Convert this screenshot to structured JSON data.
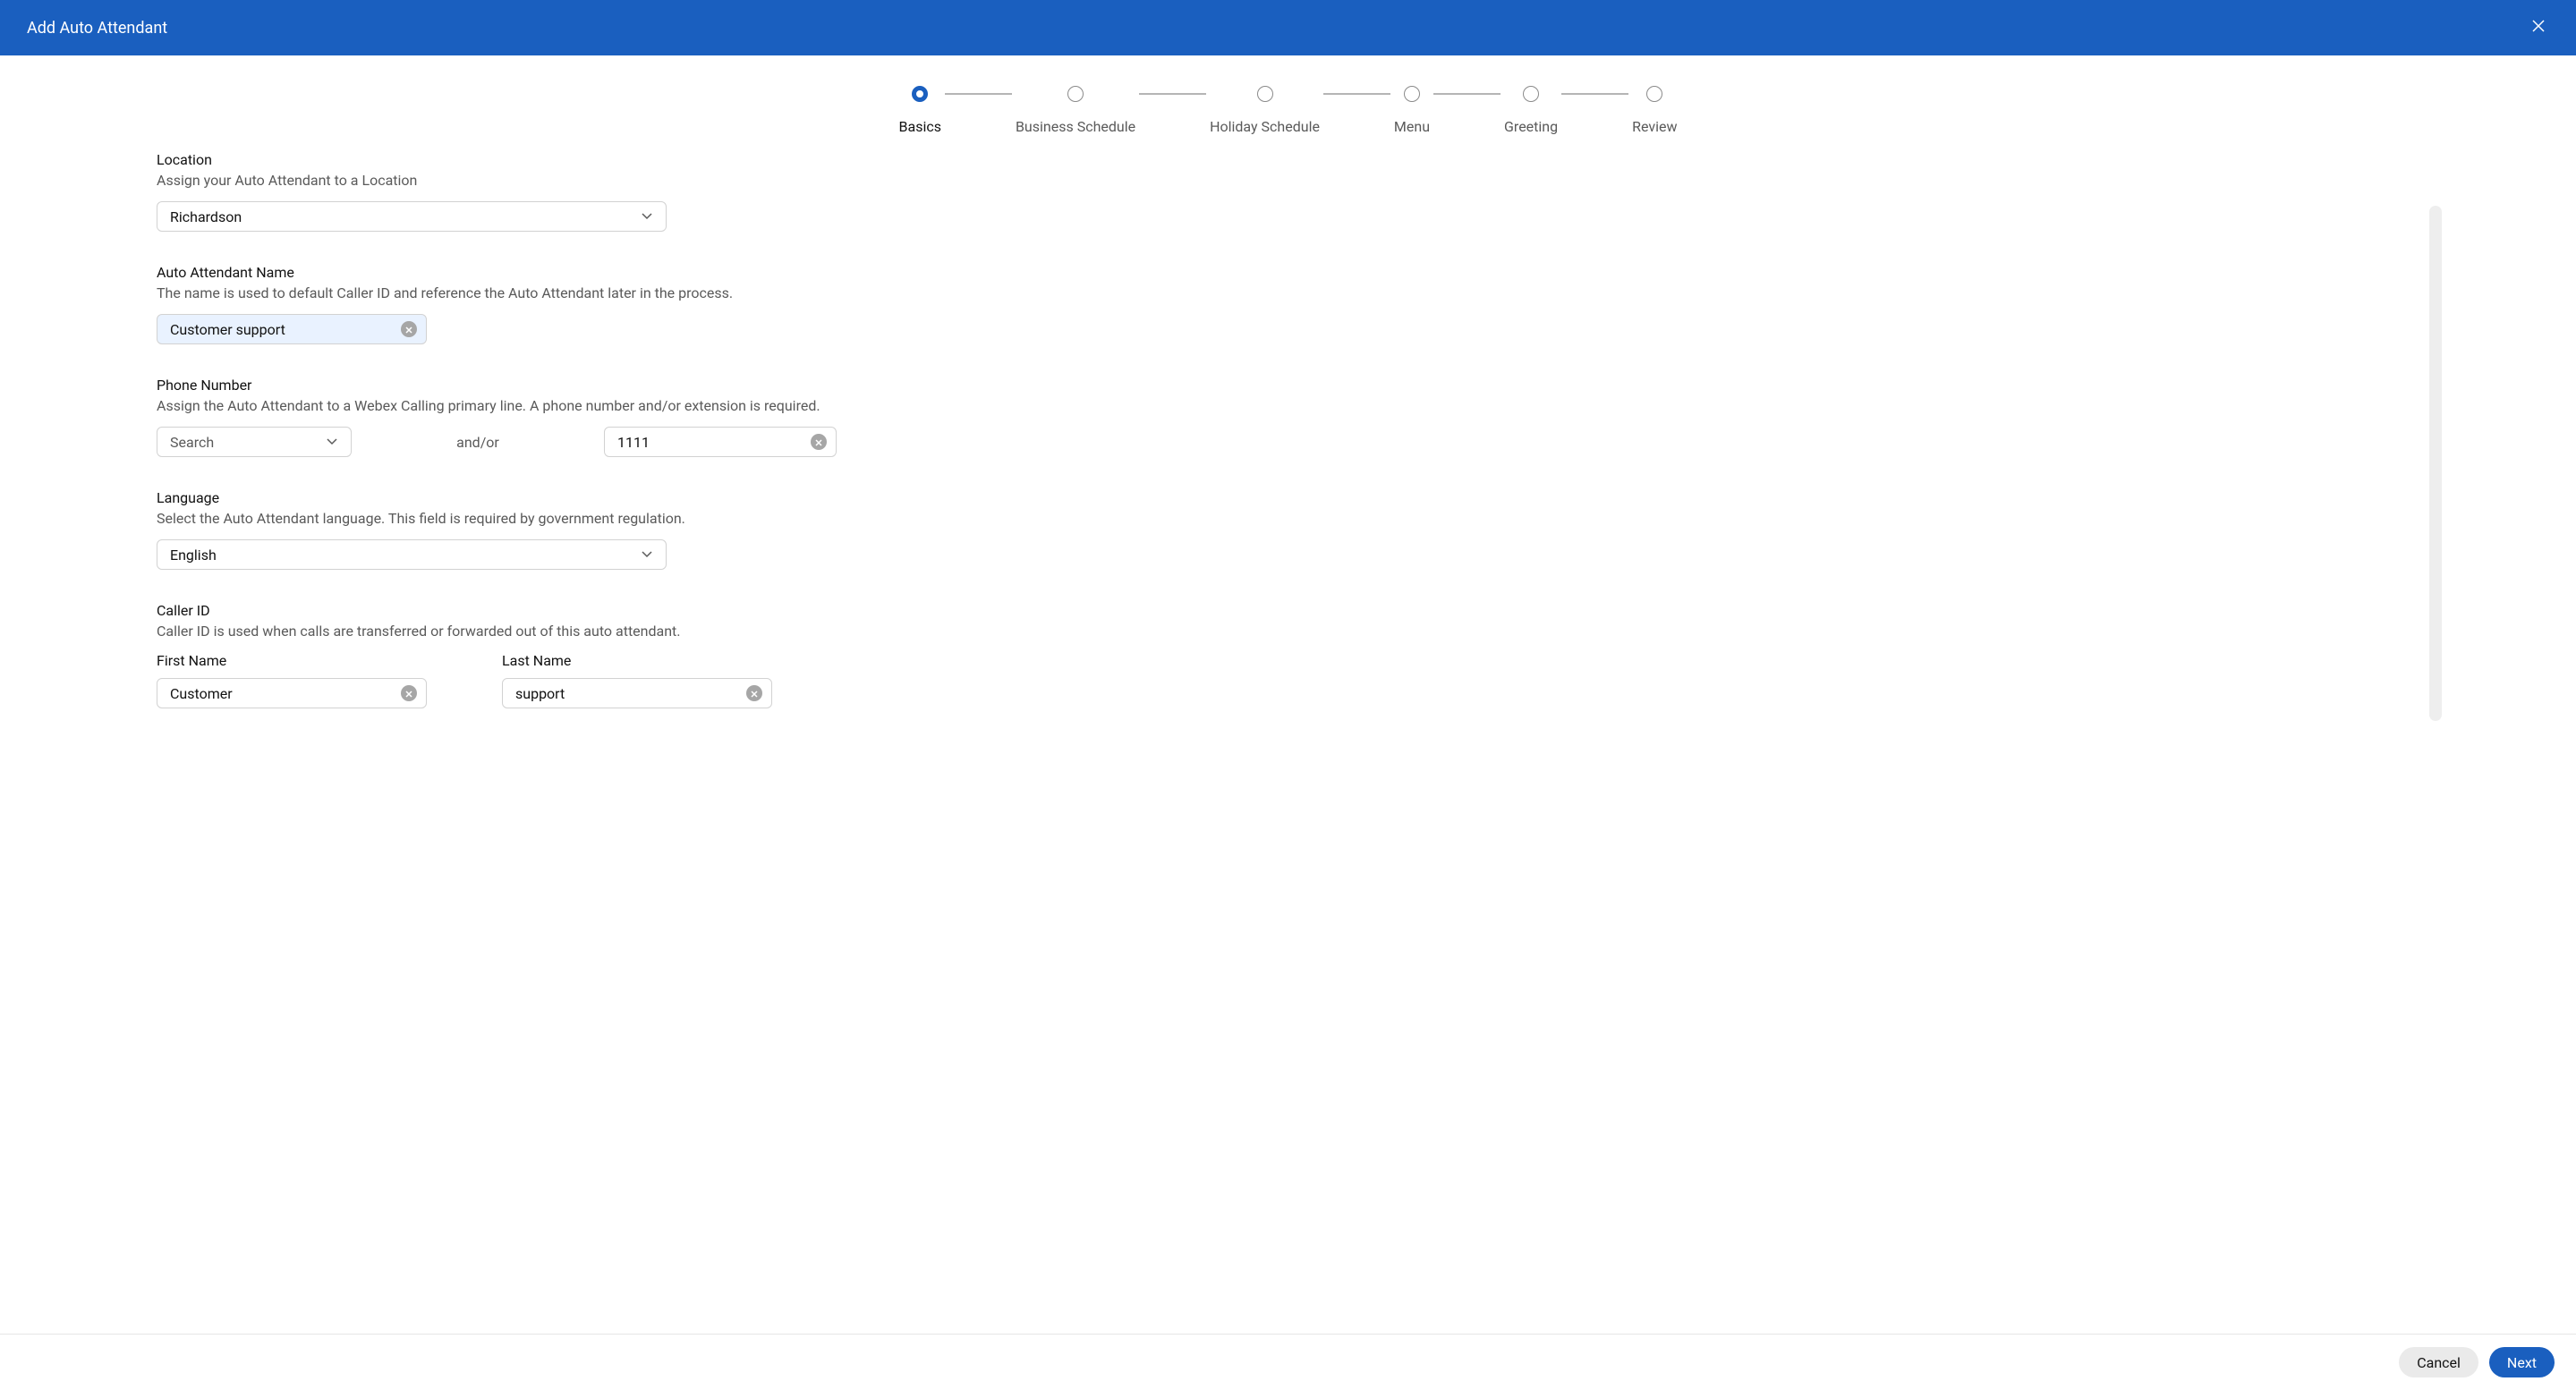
{
  "header": {
    "title": "Add Auto Attendant"
  },
  "stepper": {
    "steps": [
      {
        "label": "Basics",
        "state": "current"
      },
      {
        "label": "Business Schedule",
        "state": "inactive"
      },
      {
        "label": "Holiday Schedule",
        "state": "inactive"
      },
      {
        "label": "Menu",
        "state": "inactive"
      },
      {
        "label": "Greeting",
        "state": "inactive"
      },
      {
        "label": "Review",
        "state": "inactive"
      }
    ]
  },
  "form": {
    "location": {
      "label": "Location",
      "help": "Assign your Auto Attendant to a Location",
      "value": "Richardson"
    },
    "name": {
      "label": "Auto Attendant Name",
      "help": "The name is used to default Caller ID and reference the Auto Attendant later in the process.",
      "value": "Customer support"
    },
    "phone": {
      "label": "Phone Number",
      "help": "Assign the Auto Attendant to a Webex Calling primary line. A phone number and/or extension is required.",
      "search_placeholder": "Search",
      "andor": "and/or",
      "extension_value": "1111"
    },
    "language": {
      "label": "Language",
      "help": "Select the Auto Attendant language. This field is required by government regulation.",
      "value": "English"
    },
    "caller_id": {
      "label": "Caller ID",
      "help": "Caller ID is used when calls are transferred or forwarded out of this auto attendant.",
      "first_name_label": "First Name",
      "first_name_value": "Customer",
      "last_name_label": "Last Name",
      "last_name_value": "support"
    }
  },
  "footer": {
    "cancel": "Cancel",
    "next": "Next"
  }
}
